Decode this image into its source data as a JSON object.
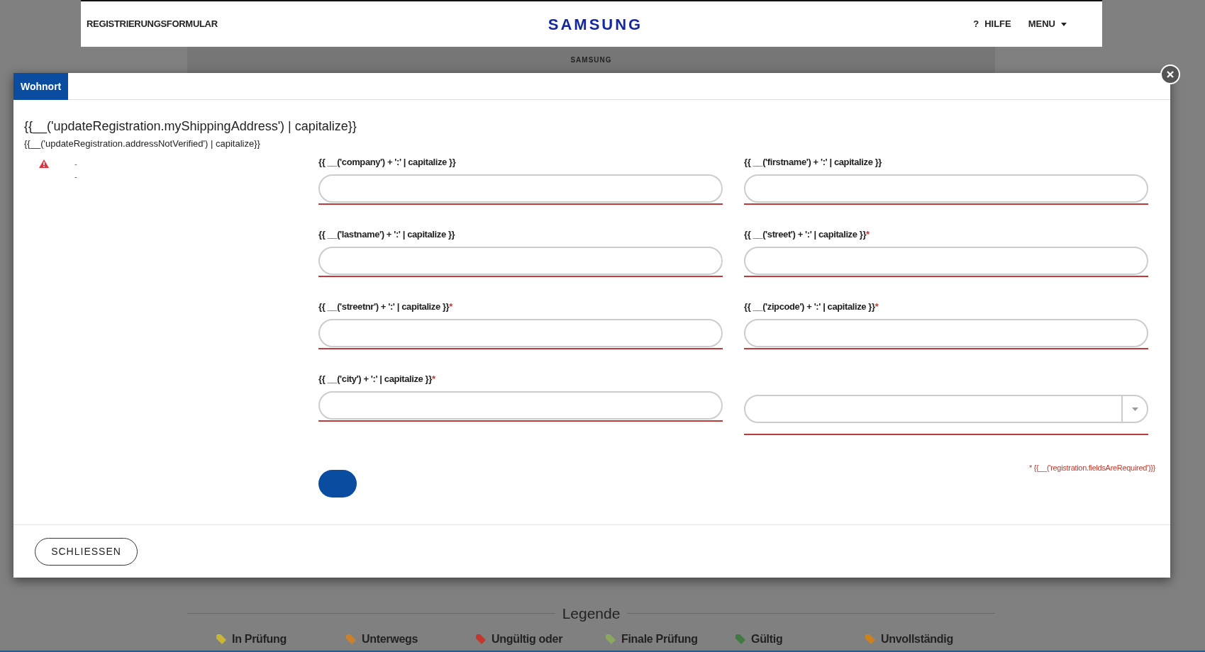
{
  "header": {
    "title": "REGISTRIERUNGSFORMULAR",
    "logo": "SAMSUNG",
    "help": {
      "icon": "?",
      "label": "HILFE"
    },
    "menu": "MENU"
  },
  "subheader": {
    "logo": "SAMSUNG"
  },
  "modal": {
    "tabs": [
      {
        "label": "Wohnort",
        "selected": true
      }
    ],
    "title": "{{__('updateRegistration.myShippingAddress') | capitalize}}",
    "subtitle": "{{__('updateRegistration.addressNotVerified') | capitalize}}",
    "warnings": [
      "-",
      "-"
    ],
    "fields": [
      {
        "kind": "text",
        "label": "{{ __('company') + ':' | capitalize }}",
        "required": false
      },
      {
        "kind": "text",
        "label": "{{ __('firstname') + ':' | capitalize }}",
        "required": false
      },
      {
        "kind": "text",
        "label": "{{ __('lastname') + ':' | capitalize }}",
        "required": false
      },
      {
        "kind": "text",
        "label": "{{ __('street') + ':' | capitalize }}",
        "required": true
      },
      {
        "kind": "text",
        "label": "{{ __('streetnr') + ':' | capitalize }}",
        "required": true
      },
      {
        "kind": "text",
        "label": "{{ __('zipcode') + ':' | capitalize }}",
        "required": true
      },
      {
        "kind": "text",
        "label": "{{ __('city') + ':' | capitalize }}",
        "required": true
      },
      {
        "kind": "select"
      }
    ],
    "required_mark": "*",
    "required_note": "* {{__('registration.fieldsAreRequired')}}",
    "close_button": "SCHLIESSEN"
  },
  "legend": {
    "title": "Legende",
    "items": [
      {
        "label": "In Prüfung",
        "color": "#c9b536"
      },
      {
        "label": "Unterwegs",
        "color": "#c7822a"
      },
      {
        "label": "Ungültig oder",
        "color": "#c0392b"
      },
      {
        "label": "Finale Prüfung",
        "color": "#8aa860"
      },
      {
        "label": "Gültig",
        "color": "#3f7a3f"
      },
      {
        "label": "Unvollständig",
        "color": "#c9821f"
      }
    ]
  }
}
